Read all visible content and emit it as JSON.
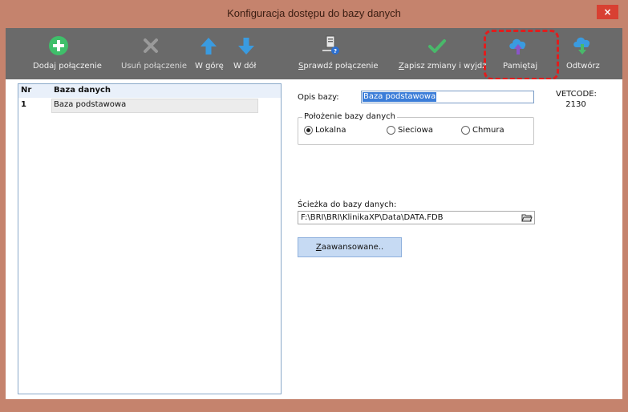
{
  "window": {
    "title": "Konfiguracja dostępu do bazy danych",
    "close_label": "×"
  },
  "toolbar": {
    "add": "Dodaj połączenie",
    "remove": "Usuń połączenie",
    "up": "W górę",
    "down": "W dół",
    "check_first": "S",
    "check_rest": "prawdź połączenie",
    "save_first": "Z",
    "save_rest": "apisz zmiany i wyjdź",
    "remember": "Pamiętaj",
    "restore": "Odtwórz"
  },
  "grid": {
    "headers": [
      "Nr",
      "Baza danych"
    ],
    "rows": [
      {
        "nr": "1",
        "name": "Baza podstawowa"
      }
    ]
  },
  "form": {
    "opis_label": "Opis bazy:",
    "opis_value": "Baza podstawowa",
    "location_title": "Położenie bazy danych",
    "location_options": [
      "Lokalna",
      "Sieciowa",
      "Chmura"
    ],
    "location_selected": "Lokalna",
    "path_label": "Ścieżka do bazy danych:",
    "path_value": "F:\\BRI\\BRI\\KlinikaXP\\Data\\DATA.FDB",
    "advanced_first": "Z",
    "advanced_rest": "aawansowane..",
    "vetcode_label": "VETCODE:",
    "vetcode_value": "2130"
  },
  "colors": {
    "window_frame": "#c5836d",
    "toolbar_bg": "#6a6a6a",
    "add_green": "#3fbf6a",
    "arrow_blue": "#3a9be0",
    "check_green": "#49b96a",
    "highlight_red": "#e11d1d"
  },
  "icons": {
    "add": "plus-circle-icon",
    "remove": "x-icon",
    "up": "arrow-up-icon",
    "down": "arrow-down-icon",
    "check": "server-check-icon",
    "save": "checkmark-icon",
    "remember": "cloud-upload-icon",
    "restore": "cloud-download-icon"
  }
}
